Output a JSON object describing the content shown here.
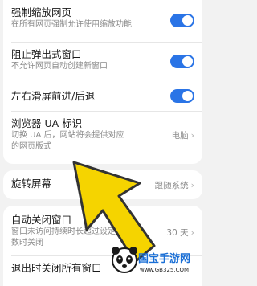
{
  "settings": [
    {
      "title": "强制缩放网页",
      "desc": "在所有网页强制允许使用缩放功能"
    },
    {
      "title": "阻止弹出式窗口",
      "desc": "不允许网页自动创建新窗口"
    },
    {
      "title": "左右滑屏前进/后退"
    },
    {
      "title": "浏览器 UA 标识",
      "desc_line1": "切换 UA 后，网站将会提供对应",
      "desc_line2": "的网页版式",
      "value": "电脑"
    },
    {
      "title": "旋转屏幕",
      "value": "跟随系统"
    },
    {
      "title": "自动关闭窗口",
      "desc_line1": "窗口未访问持续时长超过设定",
      "desc_line2": "数时关闭",
      "value": "30 天"
    },
    {
      "title": "退出时关闭所有窗口"
    }
  ],
  "colors": {
    "toggle_on": "#2a74e6",
    "arrow": "#f5d400",
    "arrow_outline": "#333333"
  },
  "watermark": {
    "brand": "国宝手游网",
    "url": "www.GB325.COM"
  }
}
